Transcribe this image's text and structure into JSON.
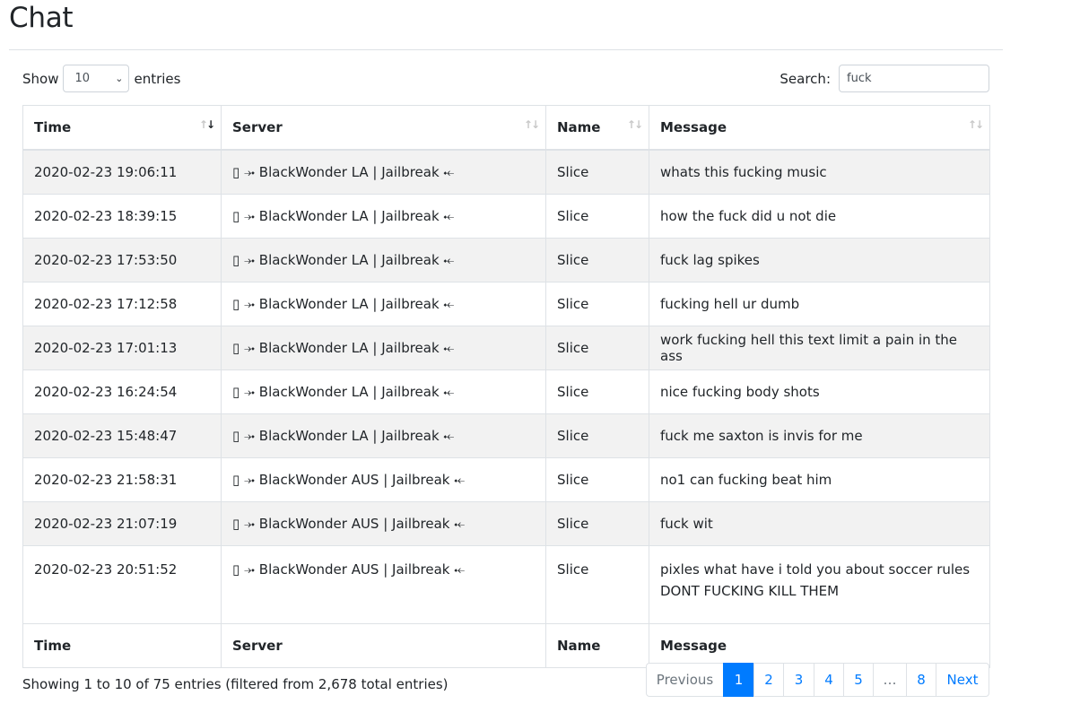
{
  "page": {
    "title": "Chat"
  },
  "length_control": {
    "show_label": "Show",
    "selected": "10",
    "entries_label": "entries"
  },
  "search": {
    "label": "Search:",
    "value": "fuck"
  },
  "table": {
    "columns": [
      "Time",
      "Server",
      "Name",
      "Message"
    ],
    "rows": [
      {
        "time": "2020-02-23 19:06:11",
        "server": "▯ ⤞ BlackWonder LA | Jailbreak ⤝",
        "name": "Slice",
        "message": "whats this fucking music"
      },
      {
        "time": "2020-02-23 18:39:15",
        "server": "▯ ⤞ BlackWonder LA | Jailbreak ⤝",
        "name": "Slice",
        "message": "how the fuck did u not die"
      },
      {
        "time": "2020-02-23 17:53:50",
        "server": "▯ ⤞ BlackWonder LA | Jailbreak ⤝",
        "name": "Slice",
        "message": "fuck lag spikes"
      },
      {
        "time": "2020-02-23 17:12:58",
        "server": "▯ ⤞ BlackWonder LA | Jailbreak ⤝",
        "name": "Slice",
        "message": "fucking hell ur dumb"
      },
      {
        "time": "2020-02-23 17:01:13",
        "server": "▯ ⤞ BlackWonder LA | Jailbreak ⤝",
        "name": "Slice",
        "message": "work fucking hell this text limit a pain in the ass"
      },
      {
        "time": "2020-02-23 16:24:54",
        "server": "▯ ⤞ BlackWonder LA | Jailbreak ⤝",
        "name": "Slice",
        "message": "nice fucking body shots"
      },
      {
        "time": "2020-02-23 15:48:47",
        "server": "▯ ⤞ BlackWonder LA | Jailbreak ⤝",
        "name": "Slice",
        "message": "fuck me saxton is invis for me"
      },
      {
        "time": "2020-02-23 21:58:31",
        "server": "▯ ⤞ BlackWonder AUS | Jailbreak ⤝",
        "name": "Slice",
        "message": "no1 can fucking beat him"
      },
      {
        "time": "2020-02-23 21:07:19",
        "server": "▯ ⤞ BlackWonder AUS | Jailbreak ⤝",
        "name": "Slice",
        "message": "fuck wit"
      },
      {
        "time": "2020-02-23 20:51:52",
        "server": "▯ ⤞ BlackWonder AUS | Jailbreak ⤝",
        "name": "Slice",
        "message": "pixles what have i told you about soccer rules DONT FUCKING KILL THEM"
      }
    ]
  },
  "info_text": "Showing 1 to 10 of 75 entries (filtered from 2,678 total entries)",
  "pagination": {
    "previous": "Previous",
    "pages": [
      "1",
      "2",
      "3",
      "4",
      "5",
      "…",
      "8"
    ],
    "next": "Next",
    "active": "1"
  },
  "colors": {
    "accent": "#007bff",
    "stripe": "#f2f2f2",
    "border": "#dee2e6"
  }
}
